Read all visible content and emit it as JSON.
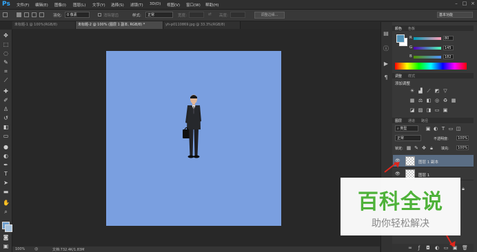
{
  "app": {
    "logo": "Ps"
  },
  "menubar": {
    "items": [
      "文件(F)",
      "编辑(E)",
      "图像(I)",
      "图层(L)",
      "文字(Y)",
      "选择(S)",
      "滤镜(T)",
      "3D(D)",
      "视图(V)",
      "窗口(W)",
      "帮助(H)"
    ],
    "window_controls": [
      "–",
      "□",
      "×"
    ]
  },
  "options": {
    "feather_label": "羽化:",
    "feather_value": "0 像素",
    "antialias_label": "消除锯齿",
    "style_label": "样式:",
    "style_value": "正常",
    "width_label": "宽度:",
    "height_label": "高度:",
    "refine_edge": "调整边缘...",
    "workspace": "基本功能"
  },
  "tabs": [
    {
      "label": "未标题-1 @ 100%(RGB/8)",
      "active": false
    },
    {
      "label": "未标题-2 @ 100% (图层 1 副本, RGB/8) *",
      "active": true
    },
    {
      "label": "yh-p0110869.jpg @ 33.3%(RGB/8)",
      "active": false
    }
  ],
  "status": {
    "zoom": "100%",
    "doc": "文档:732.4K/1.83M"
  },
  "color_panel": {
    "tabs": [
      "颜色",
      "色板"
    ],
    "channels": [
      {
        "label": "R",
        "value": "80"
      },
      {
        "label": "G",
        "value": "145"
      },
      {
        "label": "B",
        "value": "182"
      }
    ],
    "foreground": "#5091b6"
  },
  "adjustments": {
    "tabs": [
      "调整",
      "样式"
    ],
    "heading": "添加调整"
  },
  "layers_panel": {
    "tabs": [
      "图层",
      "通道",
      "路径"
    ],
    "filter_label": "类型",
    "blend_mode": "正常",
    "opacity_label": "不透明度:",
    "opacity_value": "100%",
    "lock_label": "锁定:",
    "fill_label": "填充:",
    "fill_value": "100%",
    "layers": [
      {
        "name": "图层 1 副本",
        "selected": true,
        "visible": true
      },
      {
        "name": "图层 1",
        "selected": false,
        "visible": true
      }
    ]
  },
  "watermark": {
    "title": "百科全说",
    "subtitle": "助你轻松解决"
  },
  "colors": {
    "canvas": "#7a9fe0",
    "accent_arrow": "#e0251b",
    "watermark_green": "#4fb23a"
  }
}
